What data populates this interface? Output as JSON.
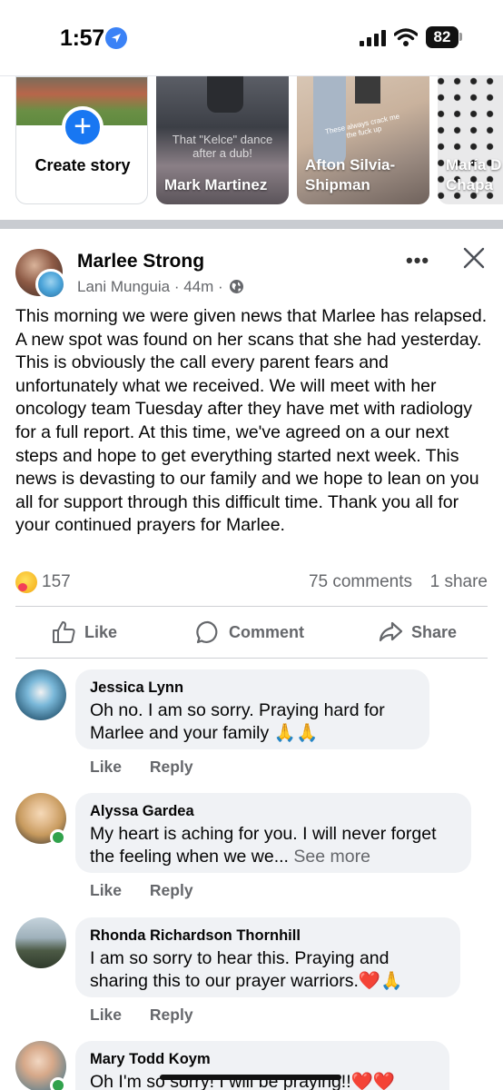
{
  "status_bar": {
    "time": "1:57",
    "battery": "82"
  },
  "stories": {
    "create_label": "Create story",
    "items": [
      {
        "name": "Mark Martinez",
        "overlay": "That \"Kelce\" dance after a dub!"
      },
      {
        "name": "Afton Silvia-Shipman",
        "overlay": "These always crack me the fuck up"
      },
      {
        "name": "María D Chapa",
        "overlay": ""
      }
    ]
  },
  "post": {
    "title": "Marlee Strong",
    "author": "Lani Munguia",
    "time": "44m",
    "body": "This morning we were given news that Marlee has relapsed. A new spot was found on her scans that she had yesterday. This is obviously  the call every parent fears and unfortunately what we received. We will meet with her oncology team Tuesday after they have met with radiology for a full report. At this time, we've agreed on a our next steps and hope to get everything started next week. This news is devasting to our family and we hope to lean on you all for support through this difficult time. Thank you all for your continued prayers for Marlee.",
    "reactions_count": "157",
    "comments_count": "75 comments",
    "shares_count": "1 share",
    "actions": {
      "like": "Like",
      "comment": "Comment",
      "share": "Share"
    }
  },
  "comments": [
    {
      "name": "Jessica Lynn",
      "text": "Oh no. I am so sorry. Praying hard for Marlee and your family 🙏🙏",
      "see_more": "",
      "like": "Like",
      "reply": "Reply"
    },
    {
      "name": "Alyssa Gardea",
      "text": "My heart is aching for you. I will never forget the feeling when we we...",
      "see_more": "See more",
      "like": "Like",
      "reply": "Reply"
    },
    {
      "name": "Rhonda Richardson Thornhill",
      "text": "I am so sorry to hear this. Praying and sharing this to our prayer warriors.❤️🙏",
      "see_more": "",
      "like": "Like",
      "reply": "Reply"
    },
    {
      "name": "Mary Todd Koym",
      "text": "Oh I'm so sorry! I will be praying!!❤️❤️",
      "see_more": "",
      "like": "",
      "reply": ""
    }
  ],
  "colors": {
    "accent": "#1877f2",
    "muted": "#65676b",
    "bubble": "#f0f2f5",
    "online": "#31a24c"
  }
}
